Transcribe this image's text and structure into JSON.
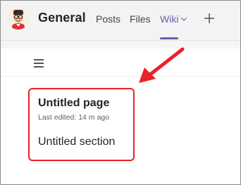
{
  "header": {
    "channel_title": "General",
    "tabs": [
      {
        "label": "Posts"
      },
      {
        "label": "Files"
      },
      {
        "label": "Wiki",
        "active": true
      }
    ],
    "active_color": "#6264a7"
  },
  "wiki": {
    "page_title": "Untitled page",
    "last_edited": "Last edited: 14 m ago",
    "section_title": "Untitled section"
  },
  "annotation": {
    "color": "#e8222a"
  },
  "icons": {
    "avatar": "avatar-icon",
    "wiki_dropdown": "chevron-down-icon",
    "add_tab": "plus-icon",
    "menu": "hamburger-menu-icon",
    "callout": "red-arrow"
  }
}
